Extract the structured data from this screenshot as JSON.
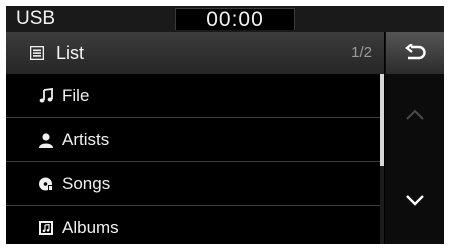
{
  "status_bar": {
    "source": "USB",
    "time": "00:00"
  },
  "header": {
    "title": "List",
    "page_indicator": "1/2",
    "title_icon": "list-icon",
    "back_icon": "back-arrow-icon"
  },
  "list": {
    "items": [
      {
        "label": "File",
        "icon": "music-note-icon"
      },
      {
        "label": "Artists",
        "icon": "person-icon"
      },
      {
        "label": "Songs",
        "icon": "disc-icon"
      },
      {
        "label": "Albums",
        "icon": "album-icon"
      }
    ]
  },
  "scroll": {
    "up_icon": "chevron-up-icon",
    "down_icon": "chevron-down-icon",
    "up_enabled": false,
    "down_enabled": true
  },
  "colors": {
    "background": "#000000",
    "text": "#f0f0f0",
    "divider": "#3d3d3d",
    "scroll_thumb": "#d8d8d8",
    "disabled": "#555555"
  }
}
